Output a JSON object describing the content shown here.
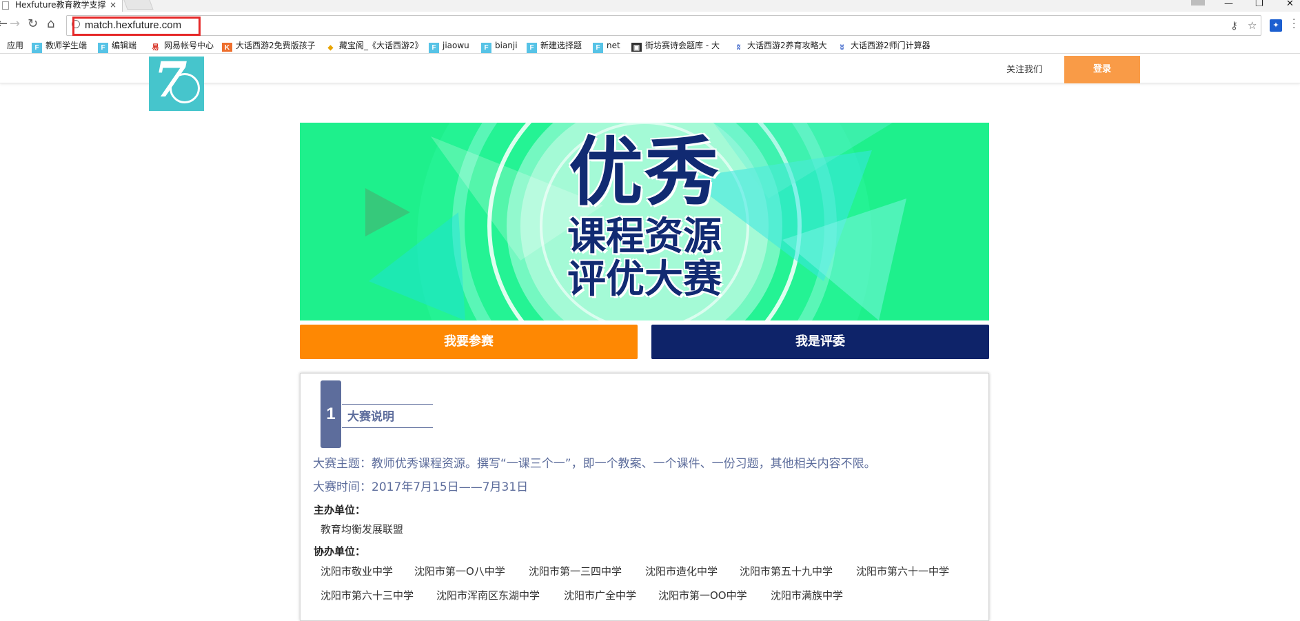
{
  "browser": {
    "tab_title": "Hexfuture教育教学支撑",
    "tab_close": "×",
    "url": "match.hexfuture.com",
    "bookmarks": [
      {
        "label": "应用",
        "icon": "apps-icon"
      },
      {
        "label": "教师学生端",
        "icon": "f-icon"
      },
      {
        "label": "编辑端",
        "icon": "f-icon"
      },
      {
        "label": "网易帐号中心",
        "icon": "netease-icon"
      },
      {
        "label": "大话西游2免费版孩子",
        "icon": "k-icon"
      },
      {
        "label": "藏宝阁_《大话西游2》",
        "icon": "treasure-icon"
      },
      {
        "label": "jiaowu",
        "icon": "f-icon"
      },
      {
        "label": "bianji",
        "icon": "f-icon"
      },
      {
        "label": "新建选择题",
        "icon": "f-icon"
      },
      {
        "label": "net",
        "icon": "f-icon"
      },
      {
        "label": "街坊赛诗会题库 - 大",
        "icon": "dark-icon"
      },
      {
        "label": "大话西游2养育攻略大",
        "icon": "butterfly-icon"
      },
      {
        "label": "大话西游2师门计算器",
        "icon": "butterfly-icon"
      }
    ]
  },
  "header": {
    "follow_us": "关注我们",
    "login": "登录"
  },
  "banner": {
    "line1": "优秀",
    "line2": "课程资源",
    "line3": "评优大赛"
  },
  "actions": {
    "join": "我要参赛",
    "judge": "我是评委"
  },
  "section": {
    "number": "1",
    "title": "大赛说明",
    "theme": "大赛主题：教师优秀课程资源。撰写“一课三个一”，即一个教案、一个课件、一份习题，其他相关内容不限。",
    "time": "大赛时间：2017年7月15日——7月31日",
    "host_label": "主办单位：",
    "host": "教育均衡发展联盟",
    "co_label": "协办单位：",
    "co_orgs": [
      "沈阳市敬业中学",
      "沈阳市第一О八中学",
      "沈阳市第一三四中学",
      "沈阳市造化中学",
      "沈阳市第五十九中学",
      "沈阳市第六十一中学",
      "沈阳市第六十三中学",
      "沈阳市浑南区东湖中学",
      "沈阳市广全中学",
      "沈阳市第一ОО中学",
      "沈阳市满族中学"
    ]
  },
  "colors": {
    "banner_bg": "#1ef08c",
    "join_button": "#fe8803",
    "judge_button": "#0e2369",
    "login_button": "#f99b47",
    "section_accent": "#5d6d9c",
    "url_highlight": "#e52828"
  }
}
